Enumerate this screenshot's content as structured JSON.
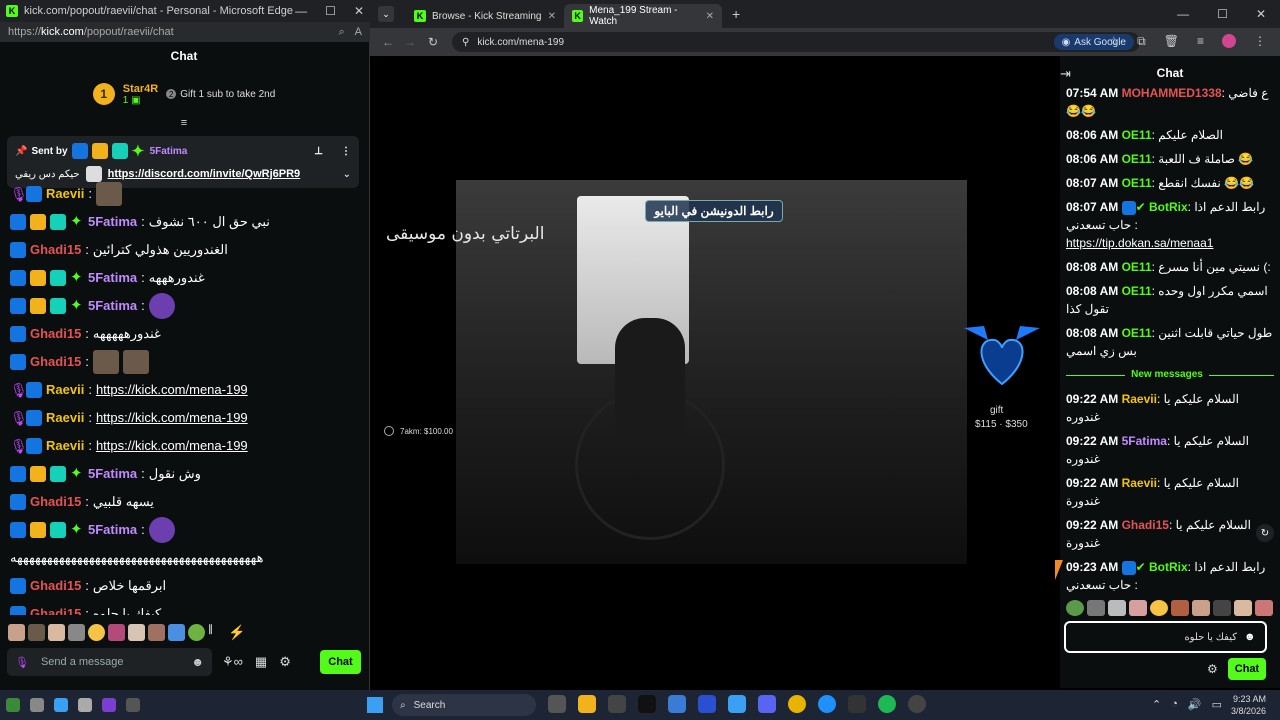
{
  "left_window": {
    "title": "kick.com/popout/raevii/chat - Personal - Microsoft Edge",
    "url_prefix": "https://",
    "url_host": "kick.com",
    "url_path": "/popout/raevii/chat",
    "chat_header": "Chat",
    "gifter": {
      "rank": "1",
      "name": "Star4R",
      "count": "1",
      "second_rank": "2",
      "cta": "Gift 1 sub to take 2nd"
    },
    "pinned": {
      "sent_by_label": "Sent by",
      "sender": "5Fatima",
      "text": "حيكم دس ريفي",
      "link": "https://discord.com/invite/QwRj6PR9"
    },
    "messages": [
      {
        "user": "Raevii",
        "color": "#f1c40f",
        "text": ""
      },
      {
        "user": "5Fatima",
        "color": "#c08bff",
        "text": "نبي حق ال ٦٠٠ نشوف"
      },
      {
        "user": "Ghadi15",
        "color": "#e55353",
        "text": "الغندوريين هذولي كترائين"
      },
      {
        "user": "5Fatima",
        "color": "#c08bff",
        "text": "غندورهههه"
      },
      {
        "user": "5Fatima",
        "color": "#c08bff",
        "text": ""
      },
      {
        "user": "Ghadi15",
        "color": "#e55353",
        "text": "غندورهههههه"
      },
      {
        "user": "Ghadi15",
        "color": "#e55353",
        "text": ""
      },
      {
        "user": "Raevii",
        "color": "#f1c40f",
        "link": "https://kick.com/mena-199"
      },
      {
        "user": "Raevii",
        "color": "#f1c40f",
        "link": "https://kick.com/mena-199"
      },
      {
        "user": "Raevii",
        "color": "#f1c40f",
        "link": "https://kick.com/mena-199"
      },
      {
        "user": "5Fatima",
        "color": "#c08bff",
        "text": "وش نقول"
      },
      {
        "user": "Ghadi15",
        "color": "#e55353",
        "text": "يسهه قلبيي"
      },
      {
        "user": "5Fatima",
        "color": "#c08bff",
        "text": ""
      },
      {
        "user": "",
        "color": "#fff",
        "text": "هههههههههههههههههههههههههههههههههههههههههه"
      },
      {
        "user": "Ghadi15",
        "color": "#e55353",
        "text": "ابرقمها خلاص"
      },
      {
        "user": "Ghadi15",
        "color": "#e55353",
        "text": "كيفك يا حلوه"
      }
    ],
    "input_placeholder": "Send a message",
    "send_label": "Chat"
  },
  "tabs": [
    {
      "label": "Browse - Kick Streaming",
      "active": false
    },
    {
      "label": "Mena_199 Stream - Watch",
      "active": true
    }
  ],
  "address": "kick.com/mena-199",
  "ask_google": "Ask Google",
  "video": {
    "badge": "رابط الدونيشن في البايو",
    "overlay_title": "البرتاتي بدون موسيقى",
    "tip": "7akm: $100.00",
    "gift_label": "gift",
    "gift_range": "$115 · $350"
  },
  "right_chat": {
    "header": "Chat",
    "messages": [
      {
        "time": "07:54 AM",
        "user": "MOHAMMED1338",
        "color": "#e55353",
        "text": "ع فاضي 😂😂"
      },
      {
        "time": "08:06 AM",
        "user": "OE11",
        "color": "#53fc18",
        "text": "الصلام عليكم"
      },
      {
        "time": "08:06 AM",
        "user": "OE11",
        "color": "#53fc18",
        "text": "صاملة ف اللعبة 😂"
      },
      {
        "time": "08:07 AM",
        "user": "OE11",
        "color": "#53fc18",
        "text": "نفسك انقطع 😂😂"
      },
      {
        "time": "08:07 AM",
        "user": "BotRix",
        "color": "#53fc18",
        "text": "رابط الدعم اذا حاب تسعدني :",
        "link": "https://tip.dokan.sa/menaa1"
      },
      {
        "time": "08:08 AM",
        "user": "OE11",
        "color": "#53fc18",
        "text": "نسيتي مين أنا مسرع (:"
      },
      {
        "time": "08:08 AM",
        "user": "OE11",
        "color": "#53fc18",
        "text": "اسمي مكرر اول وحده تقول كذا"
      },
      {
        "time": "08:08 AM",
        "user": "OE11",
        "color": "#53fc18",
        "text": "طول حياتي قابلت اثنين بس زي اسمي"
      }
    ],
    "new_label": "New messages",
    "new_messages": [
      {
        "time": "09:22 AM",
        "user": "Raevii",
        "color": "#f1c40f",
        "text": "السلام عليكم يا غندوره"
      },
      {
        "time": "09:22 AM",
        "user": "5Fatima",
        "color": "#c08bff",
        "text": "السلام عليكم يا غندوره"
      },
      {
        "time": "09:22 AM",
        "user": "Raevii",
        "color": "#f1c40f",
        "text": "السلام عليكم يا غندورة"
      },
      {
        "time": "09:22 AM",
        "user": "Ghadi15",
        "color": "#e55353",
        "text": "السلام عليكم يا غندورة"
      },
      {
        "time": "09:23 AM",
        "user": "BotRix",
        "color": "#53fc18",
        "text": "رابط الدعم اذا حاب تسعدني :",
        "link": "https://tip.dokan.sa/menaa1"
      }
    ],
    "input_value": "كيفك يا حلوه",
    "send_label": "Chat"
  },
  "taskbar": {
    "search": "Search",
    "time": "9:23 AM",
    "date": "3/8/2026"
  },
  "colors": {
    "kick_green": "#53fc18",
    "bg": "#0b0e0f"
  }
}
